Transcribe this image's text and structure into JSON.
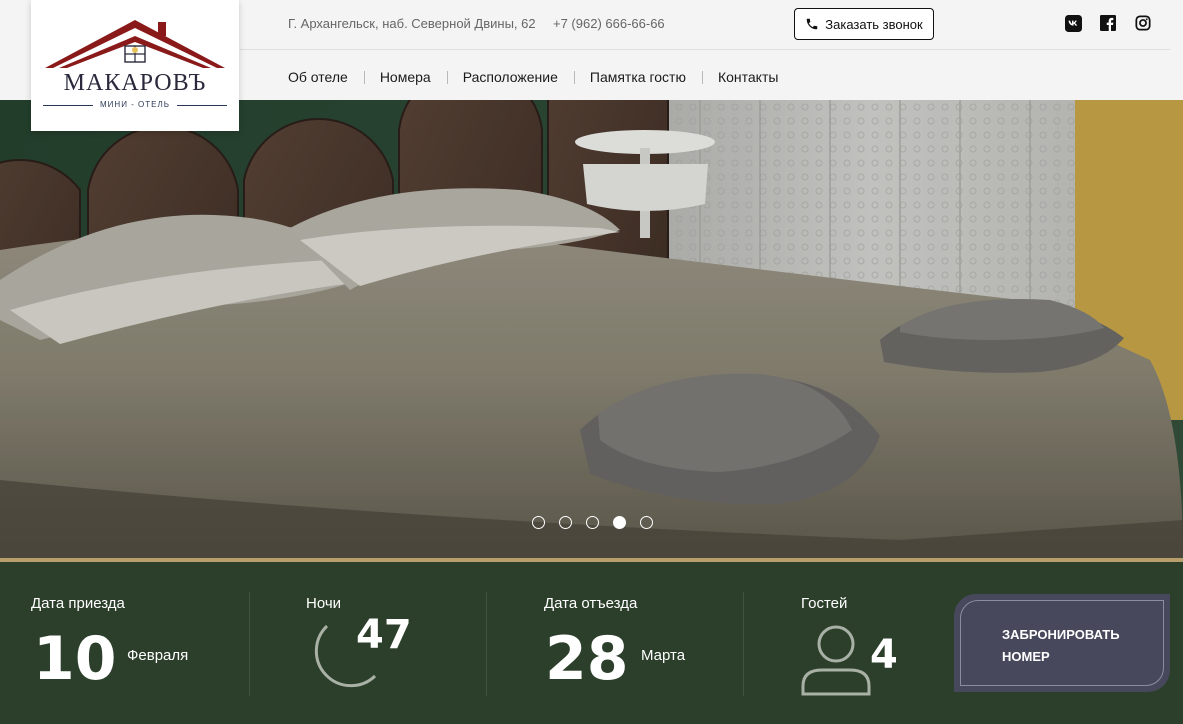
{
  "header": {
    "logo": {
      "name": "МАКАРОВЪ",
      "subtitle": "МИНИ - ОТЕЛЬ"
    },
    "address": "Г. Архангельск, наб. Северной Двины, 62",
    "phone": "+7 (962) 666-66-66",
    "callback_label": "Заказать звонок",
    "social": [
      "vk-icon",
      "facebook-icon",
      "instagram-icon"
    ]
  },
  "nav": {
    "items": [
      {
        "label": "Об отеле"
      },
      {
        "label": "Номера"
      },
      {
        "label": "Расположение"
      },
      {
        "label": "Памятка гостю"
      },
      {
        "label": "Контакты"
      }
    ]
  },
  "slider": {
    "slide_count": 5,
    "active_slide": 4
  },
  "booking": {
    "arrival": {
      "label": "Дата приезда",
      "day": "10",
      "month": "Февраля"
    },
    "nights": {
      "label": "Ночи",
      "value": "47"
    },
    "departure": {
      "label": "Дата отъезда",
      "day": "28",
      "month": "Марта"
    },
    "guests": {
      "label": "Гостей",
      "value": "4"
    },
    "book_button": {
      "line1": "ЗАБРОНИРОВАТЬ",
      "line2": "НОМЕР"
    }
  },
  "colors": {
    "accent_gold": "#b89e6b",
    "booking_bg": "#2c3f2b",
    "button_bg": "#47485c",
    "logo_red": "#8a1a1a"
  }
}
